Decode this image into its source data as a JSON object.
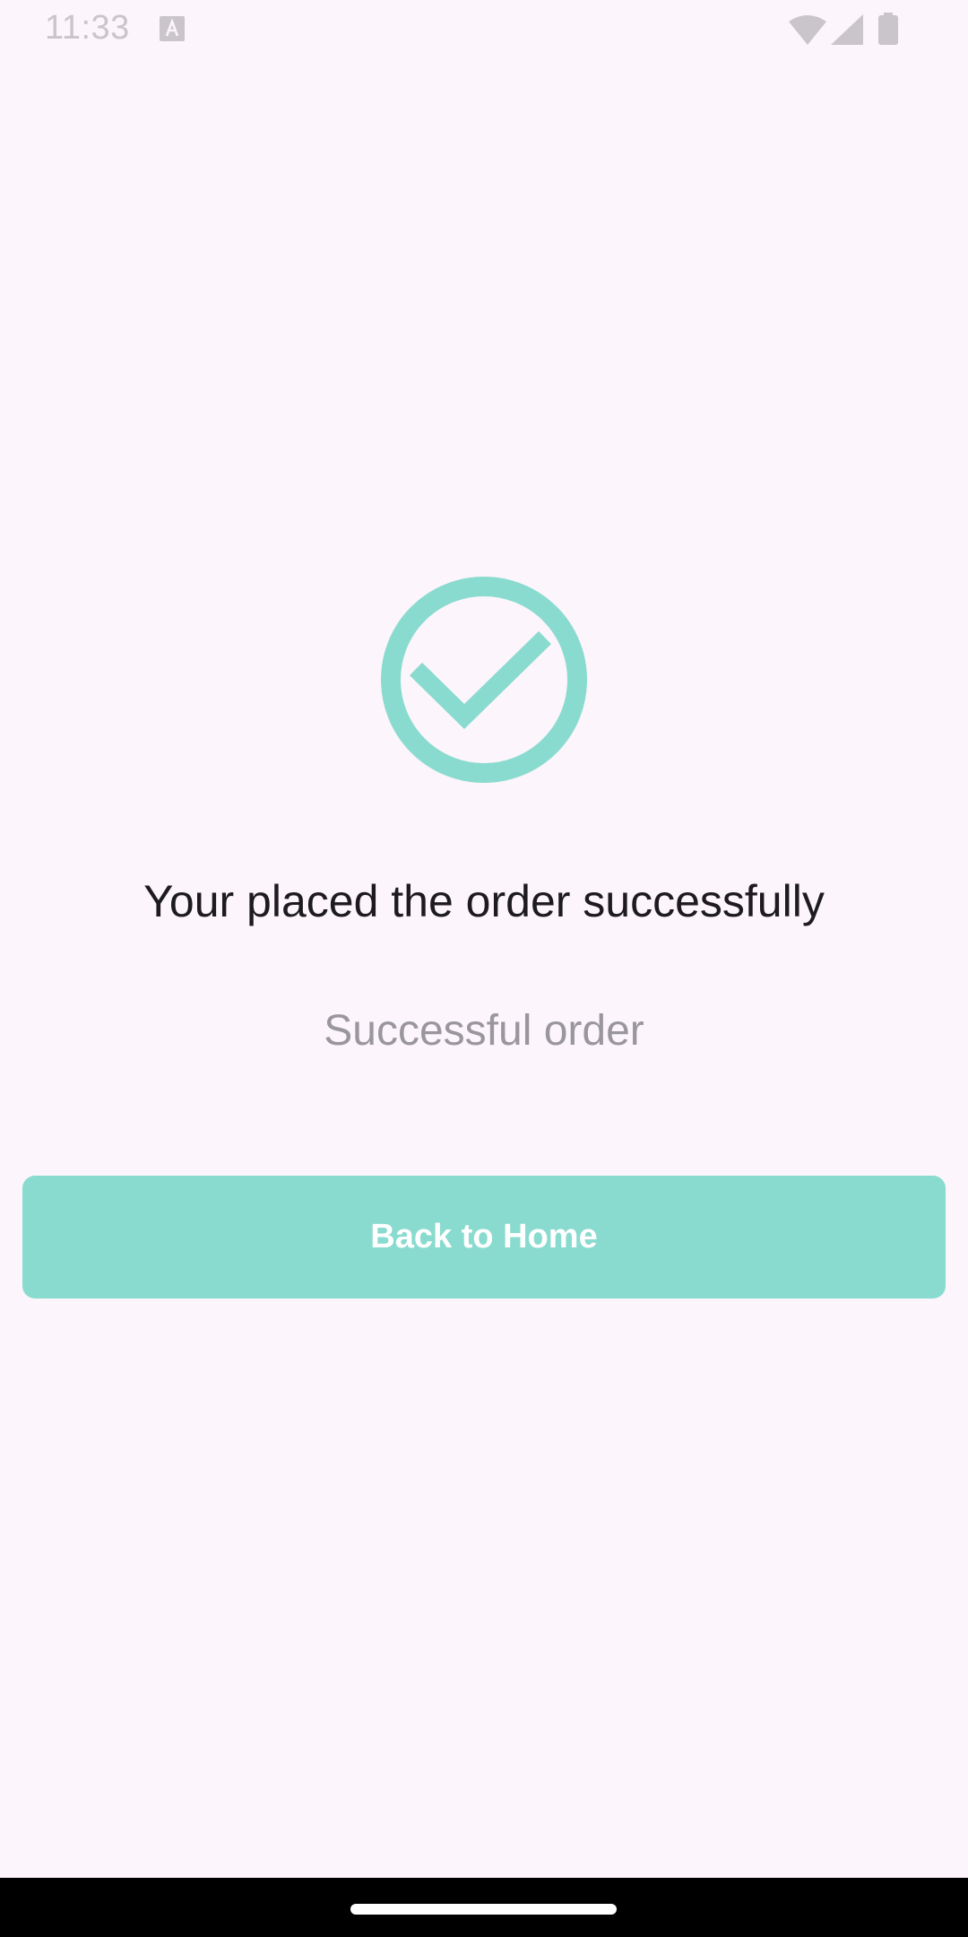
{
  "status_bar": {
    "time": "11:33",
    "notification_icon": "text-format-icon",
    "icons": [
      "wifi-icon",
      "cellular-signal-icon",
      "battery-icon"
    ]
  },
  "confirmation": {
    "icon": "check-circle-icon",
    "title": "Your placed the order successfully",
    "subtitle": "Successful order",
    "button_label": "Back to Home"
  },
  "colors": {
    "background": "#FCF5FC",
    "accent": "#8ADBCF",
    "title_text": "#1D1B20",
    "subtitle_text": "#9A969E",
    "button_text": "#FFFFFF"
  },
  "navigation": {
    "home_handle": "gesture-handle"
  }
}
